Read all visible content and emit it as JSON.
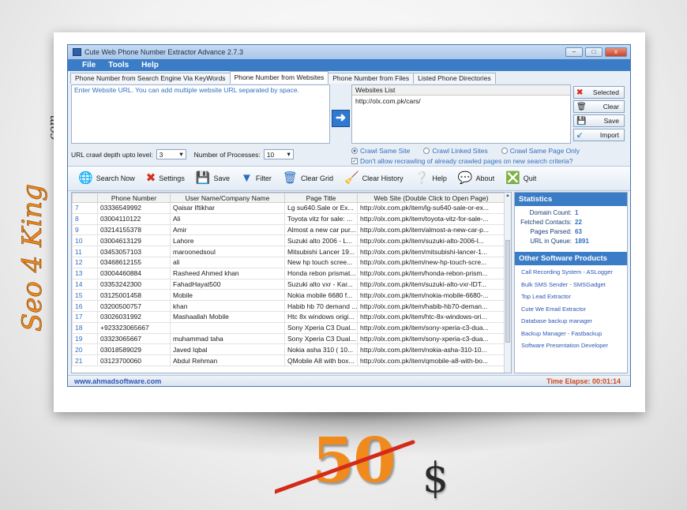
{
  "branding": {
    "side_text": "Seo 4 King",
    "side_suffix": ".com",
    "price": "50",
    "currency": "$",
    "price_color": "#f08a1c",
    "strike_color": "#d42a1a"
  },
  "window": {
    "title": "Cute Web Phone Number Extractor Advance 2.7.3",
    "controls": [
      "–",
      "□",
      "x"
    ]
  },
  "menu": [
    "File",
    "Tools",
    "Help"
  ],
  "tabs": [
    {
      "label": "Phone Number from Search Engine Via KeyWords",
      "active": false
    },
    {
      "label": "Phone Number from Websites",
      "active": true
    },
    {
      "label": "Phone Number from Files",
      "active": false
    },
    {
      "label": "Listed Phone Directories",
      "active": false
    }
  ],
  "url_input": {
    "label": "Enter Website URL. You can add multiple website URL separated by space.",
    "value": ""
  },
  "websites_list": {
    "header": "Websites List",
    "items": [
      "http://olx.com.pk/cars/"
    ]
  },
  "side_buttons": [
    {
      "label": "Selected",
      "icon": "delete-icon"
    },
    {
      "label": "Clear",
      "icon": "trash-icon"
    },
    {
      "label": "Save",
      "icon": "save-icon"
    },
    {
      "label": "Import",
      "icon": "import-icon"
    }
  ],
  "options": {
    "crawl_depth_label": "URL crawl depth upto level:",
    "crawl_depth_value": "3",
    "processes_label": "Number of Processes:",
    "processes_value": "10",
    "radio_same_site": "Crawl Same Site",
    "radio_linked_sites": "Crawl Linked Sites",
    "radio_same_page": "Crawl Same Page Only",
    "no_recrawl_label": "Don't allow recrawling of already crawled pages on new search criteria?"
  },
  "toolbar": [
    {
      "label": "Search Now",
      "icon": "globe-icon"
    },
    {
      "label": "Settings",
      "icon": "tools-icon"
    },
    {
      "label": "Save",
      "icon": "save-icon"
    },
    {
      "label": "Filter",
      "icon": "filter-icon"
    },
    {
      "label": "Clear Grid",
      "icon": "trash-icon"
    },
    {
      "label": "Clear History",
      "icon": "broom-icon"
    },
    {
      "label": "Help",
      "icon": "help-icon"
    },
    {
      "label": "About",
      "icon": "about-icon"
    },
    {
      "label": "Quit",
      "icon": "close-icon"
    }
  ],
  "grid": {
    "columns": [
      "",
      "Phone Number",
      "User Name/Company Name",
      "Page Title",
      "Web Site (Double Click to Open Page)"
    ],
    "rows": [
      [
        "7",
        "03336549992",
        "Qaisar Iftikhar",
        "Lg su640.Sale or Ex...",
        "http://olx.com.pk/item/lg-su640-sale-or-ex..."
      ],
      [
        "8",
        "03004110122",
        "Ali",
        "Toyota vitz for sale: ...",
        "http://olx.com.pk/item/toyota-vitz-for-sale-..."
      ],
      [
        "9",
        "03214155378",
        "Amir",
        "Almost a new car pur...",
        "http://olx.com.pk/item/almost-a-new-car-p..."
      ],
      [
        "10",
        "03004613129",
        "Lahore",
        "Suzuki alto 2006 - L...",
        "http://olx.com.pk/item/suzuki-alto-2006-l..."
      ],
      [
        "11",
        "03453057103",
        "maroonedsoul",
        "Mitsubishi Lancer 19...",
        "http://olx.com.pk/item/mitsubishi-lancer-1..."
      ],
      [
        "12",
        "03468612155",
        "ali",
        "New hp touch scree...",
        "http://olx.com.pk/item/new-hp-touch-scre..."
      ],
      [
        "13",
        "03004460884",
        "Rasheed Ahmed khan",
        "Honda rebon prismat...",
        "http://olx.com.pk/item/honda-rebon-prism..."
      ],
      [
        "14",
        "03353242300",
        "FahadHayat500",
        "Suzuki alto vxr - Kar...",
        "http://olx.com.pk/item/suzuki-alto-vxr-IDT..."
      ],
      [
        "15",
        "03125001458",
        "Mobile",
        "Nokia mobile 6680 f...",
        "http://olx.com.pk/item/nokia-mobile-6680-..."
      ],
      [
        "16",
        "03200500757",
        "khan",
        "Habib hb 70 demand ...",
        "http://olx.com.pk/item/habib-hb70-deman..."
      ],
      [
        "17",
        "03026031992",
        "Mashaallah Mobile",
        "Htc 8x windows origi...",
        "http://olx.com.pk/item/htc-8x-windows-ori..."
      ],
      [
        "18",
        "+923323065667",
        "",
        "Sony Xperia C3 Dual...",
        "http://olx.com.pk/item/sony-xperia-c3-dua..."
      ],
      [
        "19",
        "03323065667",
        "muhammad taha",
        "Sony Xperia C3 Dual...",
        "http://olx.com.pk/item/sony-xperia-c3-dua..."
      ],
      [
        "20",
        "03018589029",
        "Javed Iqbal",
        "Nokia asha 310 ( 10...",
        "http://olx.com.pk/item/nokia-asha-310-10..."
      ],
      [
        "21",
        "03123700060",
        "Abdul Rehman",
        "QMobile A8 with box...",
        "http://olx.com.pk/item/qmobile-a8-with-bo..."
      ]
    ]
  },
  "statistics": {
    "title": "Statistics",
    "items": [
      {
        "label": "Domain Count:",
        "value": "1"
      },
      {
        "label": "Fetched Contacts:",
        "value": "22"
      },
      {
        "label": "Pages Parsed:",
        "value": "63"
      },
      {
        "label": "URL in Queue:",
        "value": "1891"
      }
    ]
  },
  "products": {
    "title": "Other Software Products",
    "items": [
      "Call Recording System - ASLogger",
      "Bulk SMS Sender - SMSGadget",
      "Top Lead Extractor",
      "Cute We Email Extractor",
      "Database backup manager",
      "Backup Manager - Fastbackup",
      "Software Presentation Developer"
    ]
  },
  "status": {
    "site": "www.ahmadsoftware.com",
    "time_elapsed": "Time Elapse: 00:01:14"
  }
}
